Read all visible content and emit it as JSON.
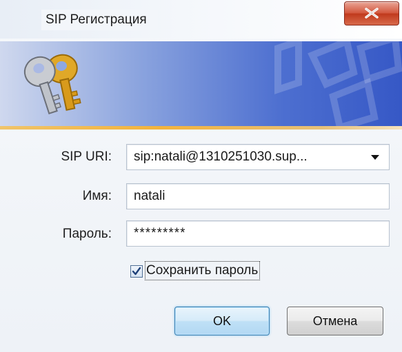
{
  "window": {
    "title": "SIP Регистрация",
    "close_icon": "close-x-icon"
  },
  "banner": {
    "icon": "keys-icon",
    "accent_color": "#4d6fd0"
  },
  "form": {
    "sip_uri": {
      "label": "SIP URI:",
      "value": "sip:natali@1310251030.sup..."
    },
    "name": {
      "label": "Имя:",
      "value": "natali"
    },
    "password": {
      "label": "Пароль:",
      "value": "*********"
    },
    "save_password": {
      "label": "Сохранить пароль",
      "checked": true
    }
  },
  "buttons": {
    "ok_label": "OK",
    "cancel_label": "Отмена"
  }
}
